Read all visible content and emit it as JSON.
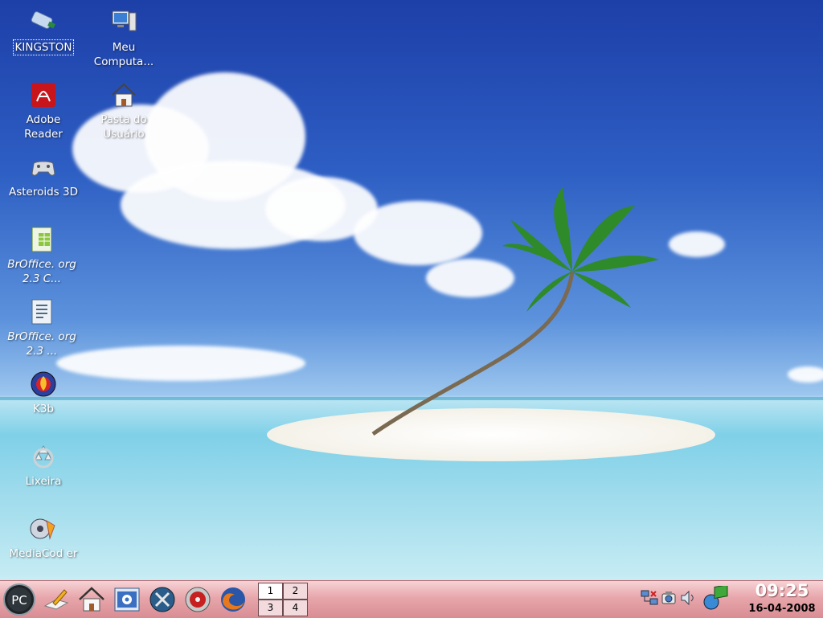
{
  "desktop": {
    "icons": [
      {
        "label": "KINGSTON",
        "icon": "usb-drive-icon"
      },
      {
        "label": "Meu Computa...",
        "icon": "computer-icon"
      },
      {
        "label": "Adobe Reader",
        "icon": "adobe-reader-icon"
      },
      {
        "label": "Pasta do Usuário",
        "icon": "home-folder-icon"
      },
      {
        "label": "Asteroids 3D",
        "icon": "gamepad-icon"
      },
      {
        "label": "BrOffice. org 2.3 C...",
        "icon": "spreadsheet-icon"
      },
      {
        "label": "BrOffice. org 2.3 ...",
        "icon": "writer-icon"
      },
      {
        "label": "K3b",
        "icon": "k3b-icon"
      },
      {
        "label": "Lixeira",
        "icon": "trash-icon"
      },
      {
        "label": "MediaCod er",
        "icon": "mediacoder-icon"
      }
    ]
  },
  "taskbar": {
    "start_label": "PC",
    "launchers": [
      "text-editor-icon",
      "home-icon",
      "control-center-icon",
      "settings-tools-icon",
      "media-player-icon",
      "firefox-icon"
    ],
    "pager": [
      "1",
      "2",
      "3",
      "4"
    ],
    "tray": [
      "network-icon",
      "screenshot-icon",
      "volume-icon",
      "network-connection-icon"
    ],
    "clock_time": "09:25",
    "clock_date": "16-04-2008"
  },
  "colors": {
    "taskbar": "#e7a6ab",
    "sky_top": "#1d3fa8",
    "sea": "#7fd0e8"
  }
}
